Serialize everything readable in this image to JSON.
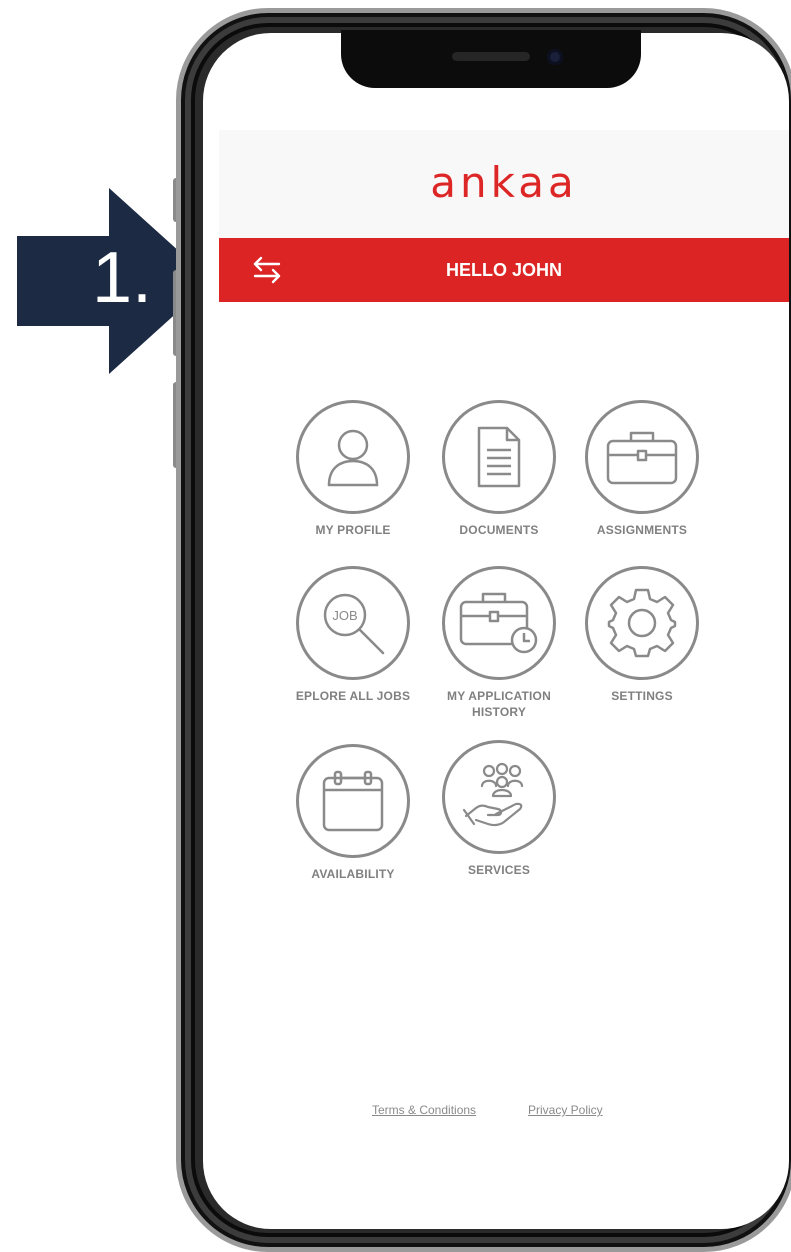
{
  "callout": {
    "label": "1."
  },
  "app": {
    "logo": "ankaa"
  },
  "header": {
    "greeting": "HELLO JOHN"
  },
  "menu": {
    "items": [
      {
        "label": "MY  PROFILE",
        "icon": "user-icon"
      },
      {
        "label": "DOCUMENTS",
        "icon": "document-icon"
      },
      {
        "label": "ASSIGNMENTS",
        "icon": "briefcase-icon"
      },
      {
        "label": "EPLORE ALL JOBS",
        "icon": "job-search-icon"
      },
      {
        "label": "MY APPLICATION HISTORY",
        "icon": "briefcase-history-icon"
      },
      {
        "label": "SETTINGS",
        "icon": "gear-icon"
      },
      {
        "label": "AVAILABILITY",
        "icon": "calendar-icon"
      },
      {
        "label": "SERVICES",
        "icon": "hand-people-icon"
      }
    ],
    "job_icon_text": "JOB"
  },
  "footer": {
    "terms": "Terms & Conditions",
    "privacy": "Privacy Policy "
  },
  "colors": {
    "brand_red": "#dd2424",
    "callout_navy": "#1c2a44",
    "icon_gray": "#8a8a8a"
  }
}
